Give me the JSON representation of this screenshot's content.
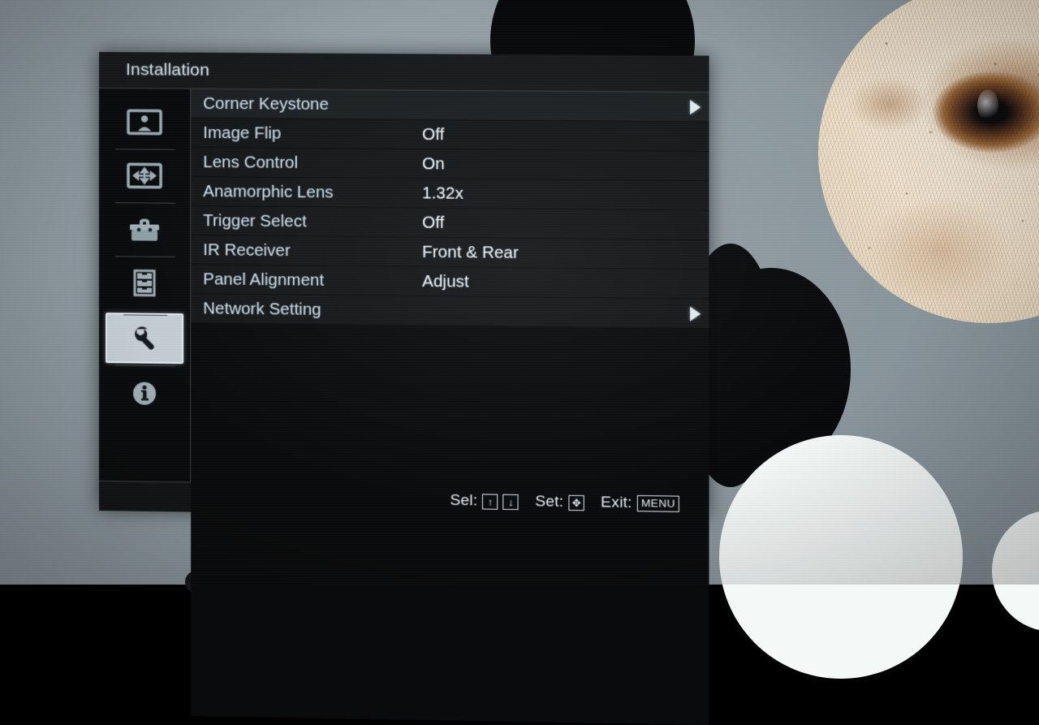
{
  "screen": {
    "device_type": "projector-osd",
    "background_description": "projected image on wall: grey field with black and white circles and a close-up textured owl face"
  },
  "osd": {
    "title": "Installation",
    "sidebar": [
      {
        "icon": "picture-screen-icon",
        "name": "picture",
        "selected": false
      },
      {
        "icon": "move-arrows-icon",
        "name": "position",
        "selected": false
      },
      {
        "icon": "toolbox-icon",
        "name": "setup",
        "selected": false
      },
      {
        "icon": "drawers-list-icon",
        "name": "signal-list",
        "selected": false
      },
      {
        "icon": "wrench-icon",
        "name": "installation",
        "selected": true
      },
      {
        "icon": "info-circle-icon",
        "name": "information",
        "selected": false
      }
    ],
    "menu_items": [
      {
        "label": "Corner Keystone",
        "value": "",
        "submenu": true,
        "highlight": true
      },
      {
        "label": "Image Flip",
        "value": "Off",
        "submenu": false,
        "highlight": false
      },
      {
        "label": "Lens Control",
        "value": "On",
        "submenu": false,
        "highlight": false
      },
      {
        "label": "Anamorphic Lens",
        "value": "1.32x",
        "submenu": false,
        "highlight": false
      },
      {
        "label": "Trigger Select",
        "value": "Off",
        "submenu": false,
        "highlight": false
      },
      {
        "label": "IR Receiver",
        "value": "Front & Rear",
        "submenu": false,
        "highlight": false
      },
      {
        "label": "Panel Alignment",
        "value": "Adjust",
        "submenu": false,
        "highlight": false
      },
      {
        "label": "Network Setting",
        "value": "",
        "submenu": true,
        "highlight": false
      }
    ],
    "footer": {
      "sel_label": "Sel:",
      "sel_up_key": "↑",
      "sel_down_key": "↓",
      "set_label": "Set:",
      "set_key": "✥",
      "exit_label": "Exit:",
      "exit_key": "MENU"
    }
  },
  "colors": {
    "panel_bg": "#0a0b0c",
    "title_bg": "#17191a",
    "row_bg": "#141617",
    "row_highlight": "#1d2022",
    "label_text": "#c9dbe6",
    "value_text": "#eef4f8",
    "selected_tab_bg": "#c4ced2",
    "wall": "#8e9ba1"
  }
}
